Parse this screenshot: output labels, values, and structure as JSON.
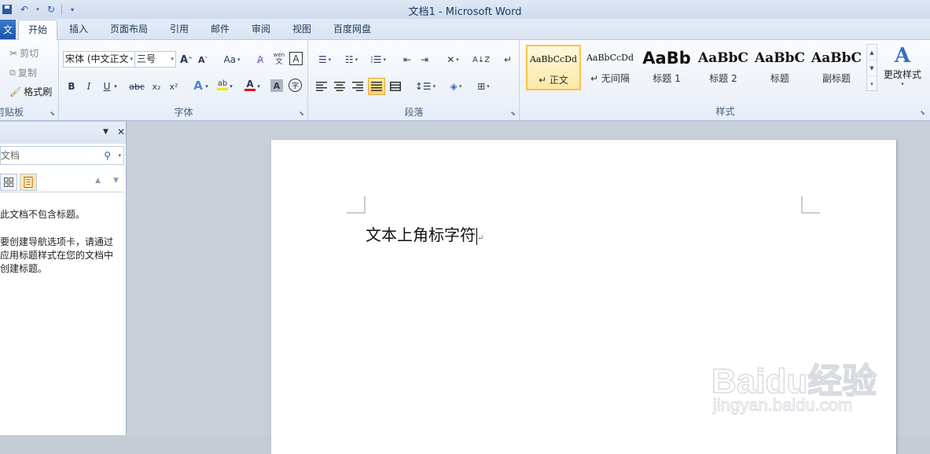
{
  "window": {
    "title": "文档1 - Microsoft Word"
  },
  "file_tab": {
    "label": "文"
  },
  "tabs": [
    {
      "label": "开始",
      "active": true
    },
    {
      "label": "插入"
    },
    {
      "label": "页面布局"
    },
    {
      "label": "引用"
    },
    {
      "label": "邮件"
    },
    {
      "label": "审阅"
    },
    {
      "label": "视图"
    },
    {
      "label": "百度网盘"
    }
  ],
  "clipboard": {
    "cut": "剪切",
    "copy": "复制",
    "format_painter": "格式刷",
    "group_label": "剪贴板"
  },
  "font": {
    "font_name": "宋体 (中文正文",
    "font_size": "三号",
    "case_label": "Aa",
    "group_label": "字体",
    "bold": "B",
    "italic": "I",
    "underline": "U",
    "strike": "abc",
    "subscript": "x₂",
    "superscript": "x²",
    "phonetic": "wén",
    "char_border": "A",
    "shading": "A",
    "enclose": "字"
  },
  "paragraph": {
    "group_label": "段落"
  },
  "styles": {
    "items": [
      {
        "preview": "AaBbCcDd",
        "name": "↵ 正文",
        "active": true
      },
      {
        "preview": "AaBbCcDd",
        "name": "↵ 无间隔"
      },
      {
        "preview": "AaBb",
        "name": "标题 1"
      },
      {
        "preview": "AaBbC",
        "name": "标题 2"
      },
      {
        "preview": "AaBbC",
        "name": "标题"
      },
      {
        "preview": "AaBbC",
        "name": "副标题"
      }
    ],
    "change_styles": "更改样式",
    "group_label": "样式"
  },
  "nav_pane": {
    "search_placeholder": "文档",
    "message_line1": "此文档不包含标题。",
    "message_lines2": [
      "要创建导航选项卡，请通过",
      "应用标题样式在您的文档中",
      "创建标题。"
    ]
  },
  "document": {
    "text": "文本上角标字符"
  },
  "watermark": {
    "brand": "Baidu经验",
    "url": "jingyan.baidu.com"
  }
}
